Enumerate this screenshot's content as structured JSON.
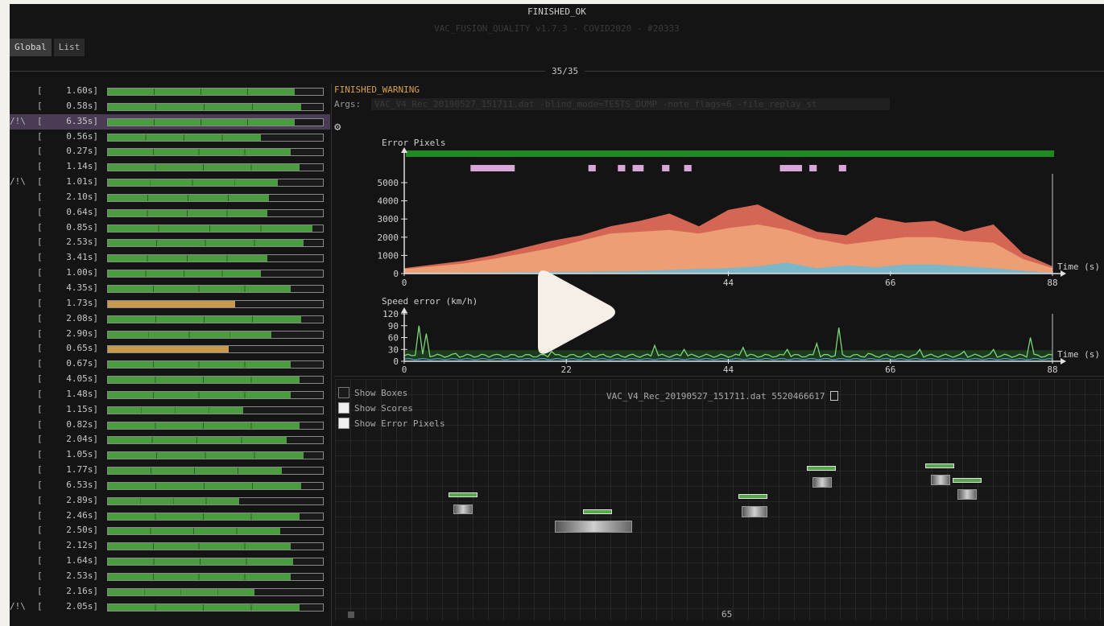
{
  "window": {
    "status_title": "FINISHED_OK",
    "subtitle": "VAC_FUSION_QUALITY v1.7.3 - COVID2020 - #20333"
  },
  "tabs": [
    {
      "label": "Global",
      "active": true
    },
    {
      "label": "List",
      "active": false
    }
  ],
  "progress": {
    "label": "35/35"
  },
  "tests": [
    {
      "warn": "",
      "time": "1.60s]",
      "fraction": 0.87,
      "color": "green"
    },
    {
      "warn": "",
      "time": "0.58s]",
      "fraction": 0.9,
      "color": "green"
    },
    {
      "warn": "/!\\",
      "time": "6.35s]",
      "fraction": 0.87,
      "color": "green",
      "selected": true
    },
    {
      "warn": "",
      "time": "0.56s]",
      "fraction": 0.71,
      "color": "green"
    },
    {
      "warn": "",
      "time": "0.27s]",
      "fraction": 0.85,
      "color": "green"
    },
    {
      "warn": "",
      "time": "1.14s]",
      "fraction": 0.89,
      "color": "green"
    },
    {
      "warn": "/!\\",
      "time": "1.01s]",
      "fraction": 0.79,
      "color": "green"
    },
    {
      "warn": "",
      "time": "2.10s]",
      "fraction": 0.75,
      "color": "green"
    },
    {
      "warn": "",
      "time": "0.64s]",
      "fraction": 0.74,
      "color": "green"
    },
    {
      "warn": "",
      "time": "0.85s]",
      "fraction": 0.95,
      "color": "green"
    },
    {
      "warn": "",
      "time": "2.53s]",
      "fraction": 0.91,
      "color": "green"
    },
    {
      "warn": "",
      "time": "3.41s]",
      "fraction": 0.74,
      "color": "green"
    },
    {
      "warn": "",
      "time": "1.00s]",
      "fraction": 0.71,
      "color": "green"
    },
    {
      "warn": "",
      "time": "4.35s]",
      "fraction": 0.85,
      "color": "green"
    },
    {
      "warn": "",
      "time": "1.73s]",
      "fraction": 0.59,
      "color": "orange"
    },
    {
      "warn": "",
      "time": "2.08s]",
      "fraction": 0.9,
      "color": "green"
    },
    {
      "warn": "",
      "time": "2.90s]",
      "fraction": 0.76,
      "color": "green"
    },
    {
      "warn": "",
      "time": "0.65s]",
      "fraction": 0.56,
      "color": "orange"
    },
    {
      "warn": "",
      "time": "0.67s]",
      "fraction": 0.85,
      "color": "green"
    },
    {
      "warn": "",
      "time": "4.05s]",
      "fraction": 0.89,
      "color": "green"
    },
    {
      "warn": "",
      "time": "1.48s]",
      "fraction": 0.85,
      "color": "green"
    },
    {
      "warn": "",
      "time": "1.15s]",
      "fraction": 0.63,
      "color": "green"
    },
    {
      "warn": "",
      "time": "0.82s]",
      "fraction": 0.89,
      "color": "green"
    },
    {
      "warn": "",
      "time": "2.04s]",
      "fraction": 0.83,
      "color": "green"
    },
    {
      "warn": "",
      "time": "1.05s]",
      "fraction": 0.91,
      "color": "green"
    },
    {
      "warn": "",
      "time": "1.77s]",
      "fraction": 0.81,
      "color": "green"
    },
    {
      "warn": "",
      "time": "6.53s]",
      "fraction": 0.9,
      "color": "green"
    },
    {
      "warn": "",
      "time": "2.89s]",
      "fraction": 0.61,
      "color": "green"
    },
    {
      "warn": "",
      "time": "2.46s]",
      "fraction": 0.89,
      "color": "green"
    },
    {
      "warn": "",
      "time": "2.50s]",
      "fraction": 0.8,
      "color": "green"
    },
    {
      "warn": "",
      "time": "2.12s]",
      "fraction": 0.85,
      "color": "green"
    },
    {
      "warn": "",
      "time": "1.64s]",
      "fraction": 0.86,
      "color": "green"
    },
    {
      "warn": "",
      "time": "2.53s]",
      "fraction": 0.85,
      "color": "green"
    },
    {
      "warn": "",
      "time": "2.16s]",
      "fraction": 0.68,
      "color": "green"
    },
    {
      "warn": "/!\\",
      "time": "2.05s]",
      "fraction": 0.89,
      "color": "green"
    }
  ],
  "details": {
    "status": "FINISHED_WARNING",
    "args_label": "Args:",
    "args_value": "VAC_V4_Rec_20190527_151711.dat -blind_mode=TESTS_DUMP -note_flags=6 -file_replay_st",
    "settings_icon": "gear-icon"
  },
  "chart_data": [
    {
      "type": "area",
      "title": "Error Pixels",
      "xlabel": "Time (s)",
      "ylabel": "",
      "xlim": [
        0,
        88
      ],
      "ylim": [
        0,
        5000
      ],
      "x_ticks": [
        0,
        44,
        66,
        88
      ],
      "y_ticks": [
        0,
        1000,
        2000,
        3000,
        4000,
        5000
      ],
      "x": [
        0,
        4,
        8,
        12,
        16,
        20,
        24,
        28,
        32,
        36,
        40,
        44,
        48,
        52,
        56,
        60,
        64,
        68,
        72,
        76,
        80,
        84,
        88
      ],
      "series": [
        {
          "color": "#e06a57",
          "values": [
            300,
            500,
            700,
            1000,
            1400,
            1800,
            2100,
            2600,
            2900,
            3300,
            2600,
            3500,
            3800,
            3000,
            2300,
            2100,
            3100,
            2800,
            2900,
            2300,
            2700,
            1100,
            400
          ]
        },
        {
          "color": "#eda277",
          "values": [
            250,
            400,
            550,
            800,
            1100,
            1400,
            1800,
            2200,
            2300,
            2400,
            2200,
            2500,
            2700,
            2400,
            1900,
            1600,
            1800,
            2000,
            2000,
            1800,
            1700,
            800,
            300
          ]
        },
        {
          "color": "#73b8cd",
          "values": [
            30,
            40,
            50,
            60,
            80,
            100,
            100,
            120,
            150,
            200,
            250,
            300,
            400,
            600,
            300,
            450,
            350,
            500,
            500,
            400,
            300,
            150,
            50
          ]
        }
      ],
      "timeline_bar": {
        "color": "#1f8a22"
      },
      "event_spans": [
        [
          9,
          15
        ],
        [
          25,
          26
        ],
        [
          29,
          30
        ],
        [
          31,
          32.5
        ],
        [
          35,
          36
        ],
        [
          38,
          39
        ],
        [
          51,
          54
        ],
        [
          55,
          56
        ],
        [
          59,
          60
        ]
      ],
      "event_color": "#d8a6d8"
    },
    {
      "type": "line",
      "title": "Speed error (km/h)",
      "xlabel": "Time (s)",
      "ylabel": "",
      "xlim": [
        0,
        88
      ],
      "ylim": [
        0,
        120
      ],
      "x_ticks": [
        0,
        22,
        44,
        66,
        88
      ],
      "y_ticks": [
        0,
        30,
        60,
        90,
        120
      ],
      "series": [
        {
          "color": "#7ad87a",
          "spikes": [
            [
              2,
              90
            ],
            [
              3,
              70
            ],
            [
              7,
              20
            ],
            [
              12,
              15
            ],
            [
              20,
              25
            ],
            [
              25,
              20
            ],
            [
              34,
              40
            ],
            [
              38,
              30
            ],
            [
              46,
              35
            ],
            [
              52,
              30
            ],
            [
              56,
              45
            ],
            [
              59,
              85
            ],
            [
              63,
              20
            ],
            [
              70,
              30
            ],
            [
              76,
              25
            ],
            [
              80,
              30
            ],
            [
              85,
              60
            ]
          ],
          "baseline": 10
        },
        {
          "color": "#4c8fd0",
          "spikes": [],
          "baseline": 4
        }
      ]
    }
  ],
  "viewport": {
    "checkboxes": [
      {
        "label": "Show Boxes",
        "checked": false
      },
      {
        "label": "Show Scores",
        "checked": true
      },
      {
        "label": "Show Error Pixels",
        "checked": true
      }
    ],
    "file_label": "VAC_V4_Rec_20190527_151711.dat 5520466617",
    "copy_icon": "copy-icon",
    "frame_number": "65"
  },
  "overlay": {
    "play_icon": "play-icon",
    "play_color": "#f5efe7"
  }
}
